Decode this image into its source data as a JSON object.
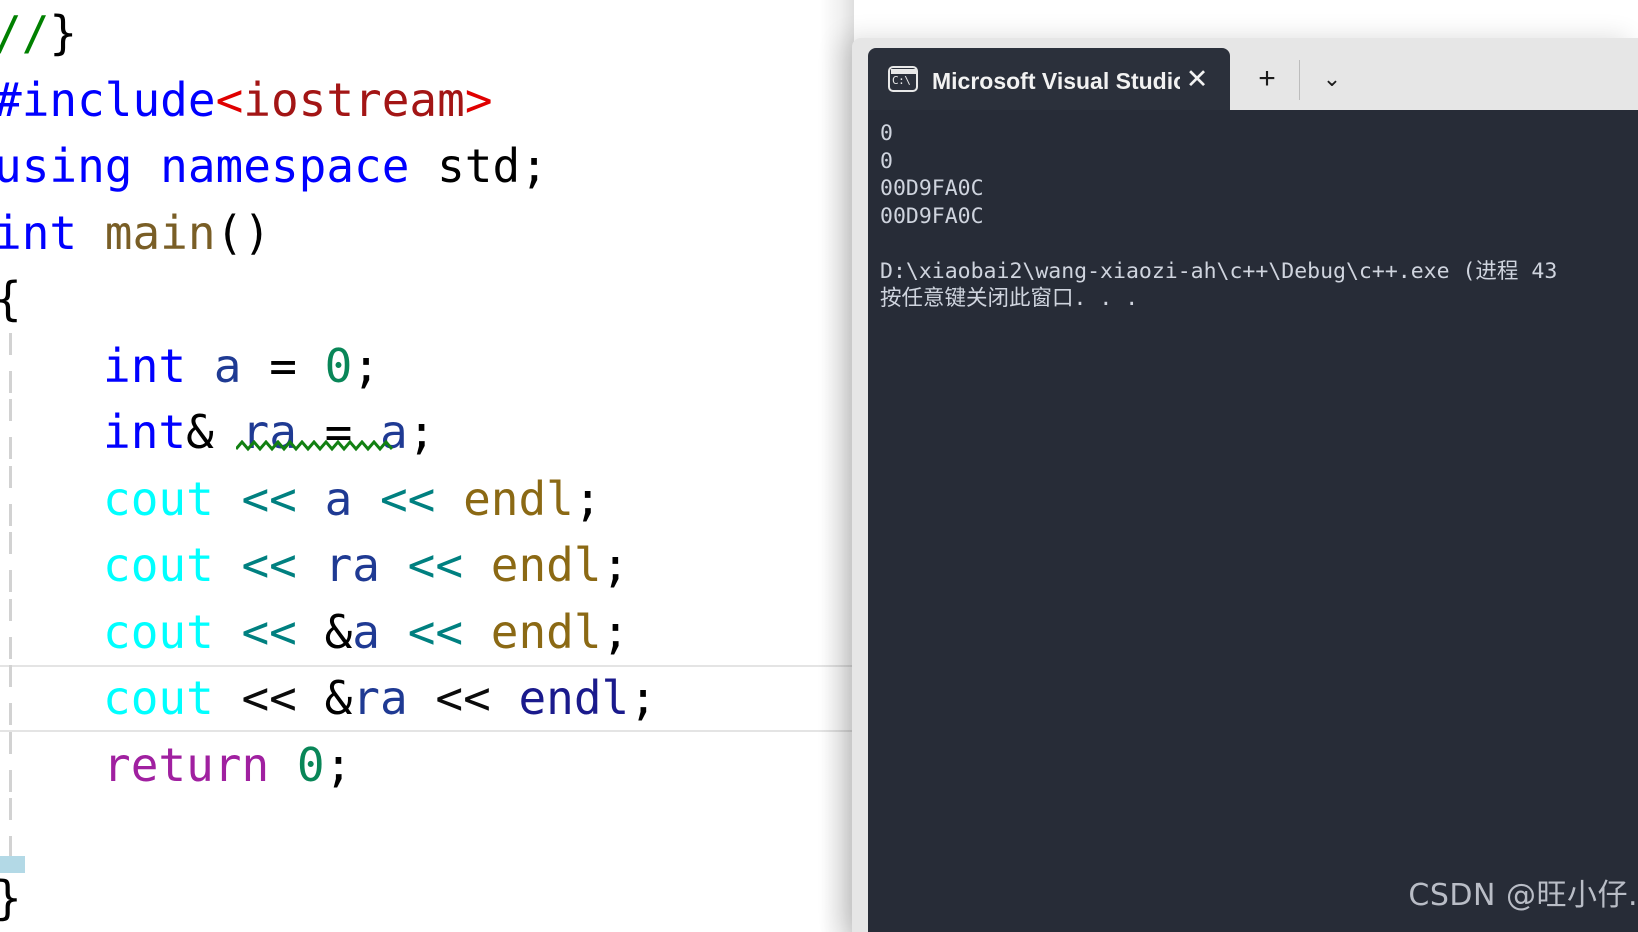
{
  "editor": {
    "name": "visual-studio-code-editor",
    "lines": [
      {
        "id": "l1",
        "indent": 0,
        "tokens": [
          {
            "t": "//",
            "c": "cmt"
          },
          {
            "t": "}",
            "c": "brace"
          }
        ]
      },
      {
        "id": "l2",
        "indent": 0,
        "tokens": [
          {
            "t": "#include",
            "c": "pre"
          },
          {
            "t": "<",
            "c": "angle"
          },
          {
            "t": "iostream",
            "c": "str"
          },
          {
            "t": ">",
            "c": "angle"
          }
        ]
      },
      {
        "id": "l3",
        "indent": 0,
        "tokens": [
          {
            "t": "using namespace",
            "c": "kw"
          },
          {
            "t": " std;",
            "c": "plain"
          }
        ]
      },
      {
        "id": "l4",
        "indent": 0,
        "tokens": [
          {
            "t": "int",
            "c": "kw"
          },
          {
            "t": " ",
            "c": "plain"
          },
          {
            "t": "main",
            "c": "func"
          },
          {
            "t": "()",
            "c": "plain"
          }
        ]
      },
      {
        "id": "l5",
        "indent": 0,
        "tokens": [
          {
            "t": "{",
            "c": "brace"
          }
        ]
      },
      {
        "id": "l6",
        "indent": 1,
        "tokens": [
          {
            "t": "int",
            "c": "kw"
          },
          {
            "t": " ",
            "c": "plain"
          },
          {
            "t": "a",
            "c": "var"
          },
          {
            "t": " = ",
            "c": "plain"
          },
          {
            "t": "0",
            "c": "num"
          },
          {
            "t": ";",
            "c": "plain"
          }
        ]
      },
      {
        "id": "l7",
        "indent": 1,
        "tokens": [
          {
            "t": "int",
            "c": "kw"
          },
          {
            "t": "&",
            "c": "amp"
          },
          {
            "t": " ",
            "c": "plain"
          },
          {
            "t": "ra",
            "c": "var"
          },
          {
            "t": " = ",
            "c": "plain"
          },
          {
            "t": "a",
            "c": "var"
          },
          {
            "t": ";",
            "c": "plain"
          }
        ]
      },
      {
        "id": "l8",
        "indent": 1,
        "tokens": [
          {
            "t": "cout",
            "c": "cout"
          },
          {
            "t": " ",
            "c": "plain"
          },
          {
            "t": "<<",
            "c": "shift"
          },
          {
            "t": " ",
            "c": "plain"
          },
          {
            "t": "a",
            "c": "var"
          },
          {
            "t": " ",
            "c": "plain"
          },
          {
            "t": "<<",
            "c": "shift"
          },
          {
            "t": " ",
            "c": "plain"
          },
          {
            "t": "endl",
            "c": "endl"
          },
          {
            "t": ";",
            "c": "plain"
          }
        ]
      },
      {
        "id": "l9",
        "indent": 1,
        "tokens": [
          {
            "t": "cout",
            "c": "cout"
          },
          {
            "t": " ",
            "c": "plain"
          },
          {
            "t": "<<",
            "c": "shift"
          },
          {
            "t": " ",
            "c": "plain"
          },
          {
            "t": "ra",
            "c": "var"
          },
          {
            "t": " ",
            "c": "plain"
          },
          {
            "t": "<<",
            "c": "shift"
          },
          {
            "t": " ",
            "c": "plain"
          },
          {
            "t": "endl",
            "c": "endl"
          },
          {
            "t": ";",
            "c": "plain"
          }
        ]
      },
      {
        "id": "l10",
        "indent": 1,
        "tokens": [
          {
            "t": "cout",
            "c": "cout"
          },
          {
            "t": " ",
            "c": "plain"
          },
          {
            "t": "<<",
            "c": "shift"
          },
          {
            "t": " ",
            "c": "plain"
          },
          {
            "t": "&",
            "c": "amp"
          },
          {
            "t": "a",
            "c": "var"
          },
          {
            "t": " ",
            "c": "plain"
          },
          {
            "t": "<<",
            "c": "shift"
          },
          {
            "t": " ",
            "c": "plain"
          },
          {
            "t": "endl",
            "c": "endl"
          },
          {
            "t": ";",
            "c": "plain"
          }
        ]
      },
      {
        "id": "l11",
        "indent": 1,
        "current": true,
        "tokens": [
          {
            "t": "cout",
            "c": "cout"
          },
          {
            "t": " ",
            "c": "plain"
          },
          {
            "t": "<<",
            "c": "shift-cur"
          },
          {
            "t": " ",
            "c": "plain"
          },
          {
            "t": "&",
            "c": "amp"
          },
          {
            "t": "ra",
            "c": "var"
          },
          {
            "t": " ",
            "c": "plain"
          },
          {
            "t": "<<",
            "c": "shift-cur"
          },
          {
            "t": " ",
            "c": "plain"
          },
          {
            "t": "endl",
            "c": "endl-cur"
          },
          {
            "t": ";",
            "c": "plain"
          }
        ]
      },
      {
        "id": "l12",
        "indent": 1,
        "tokens": [
          {
            "t": "return",
            "c": "ret"
          },
          {
            "t": " ",
            "c": "plain"
          },
          {
            "t": "0",
            "c": "num"
          },
          {
            "t": ";",
            "c": "plain"
          }
        ]
      },
      {
        "id": "l13",
        "indent": 0,
        "tokens": []
      },
      {
        "id": "l14",
        "indent": 0,
        "tokens": [
          {
            "t": "}",
            "c": "brace"
          }
        ]
      }
    ],
    "squiggle_label": "error-squiggle-under-ra-equals-a",
    "selection_label": "text-selection-highlight"
  },
  "console_window": {
    "tab": {
      "icon": "command-prompt-icon",
      "icon_text": "C:\\",
      "title": "Microsoft Visual Studio 调试控",
      "close_label": "✕"
    },
    "new_tab_label": "+",
    "dropdown_label": "⌄",
    "output_lines": [
      "0",
      "0",
      "00D9FA0C",
      "00D9FA0C",
      "",
      "D:\\xiaobai2\\wang-xiaozi-ah\\c++\\Debug\\c++.exe (进程 43",
      "按任意键关闭此窗口. . ."
    ],
    "watermark": "CSDN @旺小仔."
  },
  "colors": {
    "console_bg": "#272c37",
    "console_text": "#cfd4de",
    "tabstrip_bg": "#e6e6e6",
    "active_tab_bg": "#2b303b",
    "editor_bg": "#ffffff",
    "selection": "#b3d9e6",
    "keyword": "#0000ff",
    "cout": "#00ffff",
    "shift_operator": "#008080",
    "endl": "#8b6914",
    "variable": "#1f3a93",
    "number": "#098658",
    "comment": "#008000",
    "string": "#a31515",
    "function": "#795e26",
    "return_keyword": "#a020a0"
  }
}
